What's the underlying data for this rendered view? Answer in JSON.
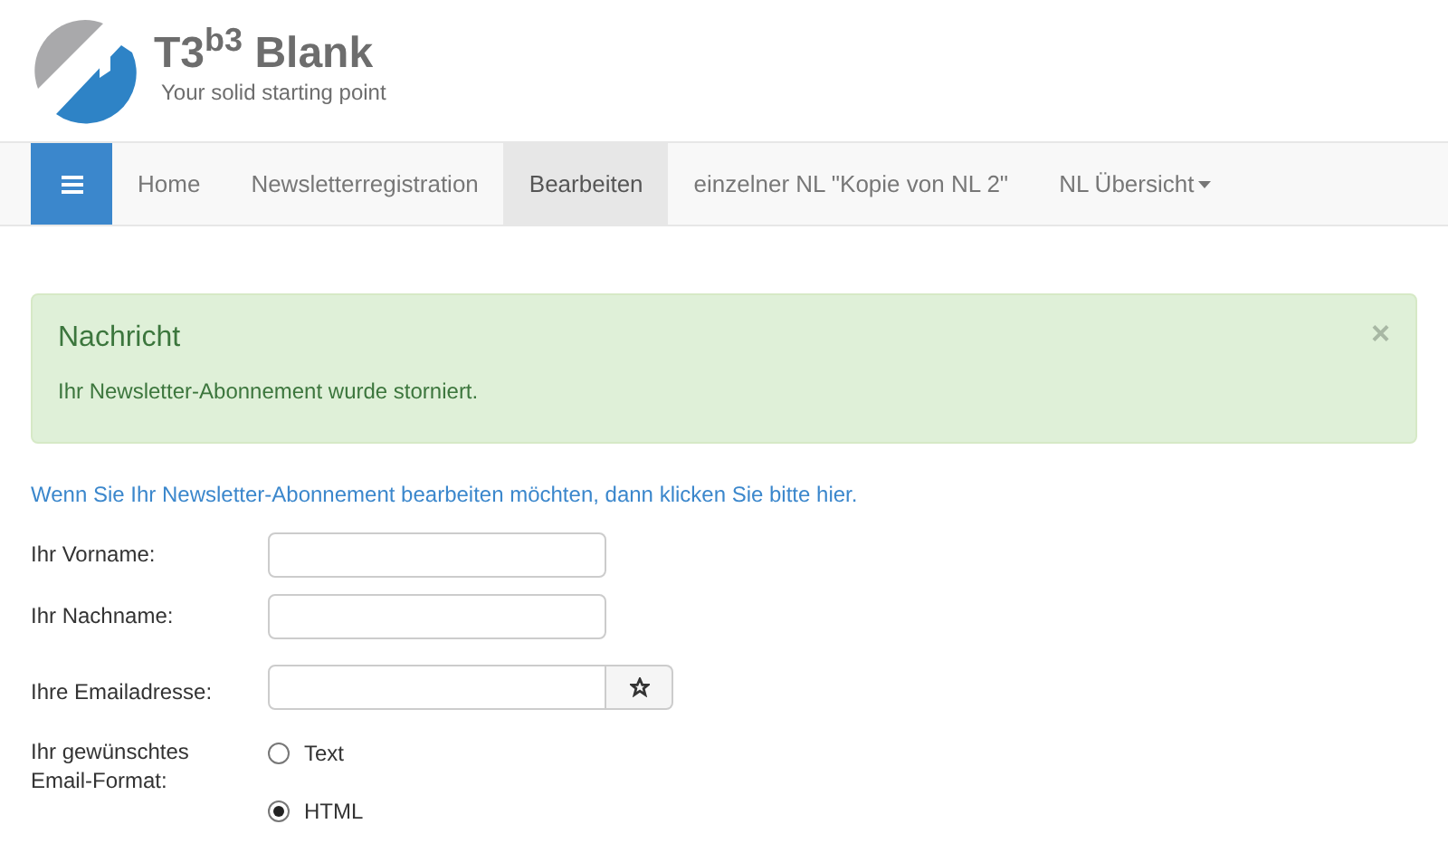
{
  "logo": {
    "title": "T3$^{b3}$ Blank",
    "tagline": "Your solid starting point"
  },
  "nav": {
    "items": [
      {
        "label": "Home",
        "selected": false,
        "dropdown": false
      },
      {
        "label": "Newsletterregistration",
        "selected": false,
        "dropdown": false
      },
      {
        "label": "Bearbeiten",
        "selected": true,
        "dropdown": false
      },
      {
        "label": "einzelner NL \"Kopie von NL 2\"",
        "selected": false,
        "dropdown": false
      },
      {
        "label": "NL Übersicht",
        "selected": false,
        "dropdown": true
      }
    ]
  },
  "alert": {
    "title": "Nachricht",
    "message": "Ihr Newsletter-Abonnement wurde storniert.",
    "close": "×"
  },
  "edit_link": "Wenn Sie Ihr Newsletter-Abonnement bearbeiten möchten, dann klicken Sie bitte hier.",
  "form": {
    "fields": [
      {
        "label": "Ihr Vorname:",
        "kind": "text"
      },
      {
        "label": "Ihr Nachname:",
        "kind": "text"
      },
      {
        "label": "Ihre Emailadresse:",
        "kind": "email"
      }
    ],
    "format": {
      "label": "Ihr gewünschtes Email-Format:",
      "options": [
        {
          "label": "Text",
          "selected": false
        },
        {
          "label": "HTML",
          "selected": true
        }
      ]
    }
  }
}
